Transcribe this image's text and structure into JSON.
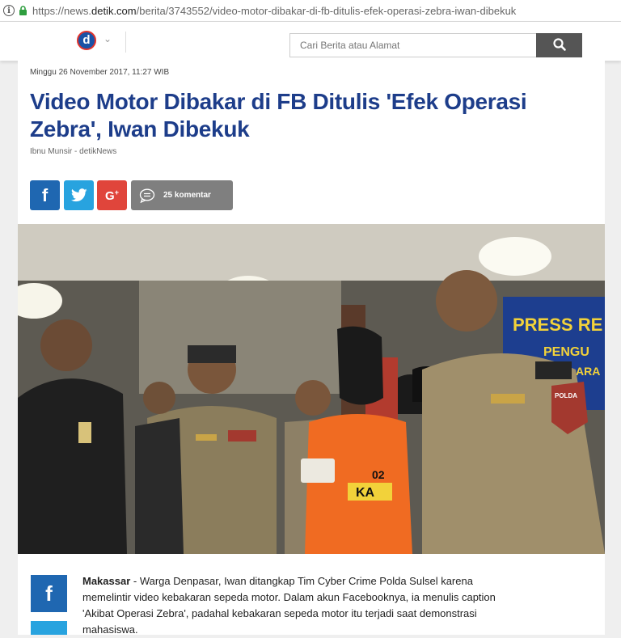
{
  "browser": {
    "url_prefix": "https://news.",
    "url_domain": "detik.com",
    "url_path": "/berita/3743552/video-motor-dibakar-di-fb-ditulis-efek-operasi-zebra-iwan-dibekuk"
  },
  "header": {
    "logo_letter": "d",
    "search_placeholder": "Cari Berita atau Alamat"
  },
  "article": {
    "date": "Minggu 26 November 2017, 11:27 WIB",
    "title": "Video Motor Dibakar di FB Ditulis 'Efek Operasi Zebra', Iwan Dibekuk",
    "author": "Ibnu Munsir - detikNews",
    "comments_label": "25 komentar",
    "location": "Makassar",
    "lead": " - Warga Denpasar, Iwan ditangkap Tim Cyber Crime Polda Sulsel karena memelintir video kebakaran sepeda motor. Dalam akun Facebooknya, ia menulis caption 'Akibat Operasi Zebra', padahal kebakaran sepeda motor itu terjadi saat demonstrasi mahasiswa."
  },
  "photo": {
    "banner_line1": "PRESS RE",
    "banner_line2": "PENGU",
    "banner_line3": "ARA",
    "shirt_number": "02",
    "shirt_text": "KA",
    "badge_text": "POLDA"
  },
  "colors": {
    "title": "#1d3d8a",
    "facebook": "#1f67b1",
    "twitter": "#28a3df",
    "googleplus": "#e0453b",
    "comments": "#7f7f7f"
  }
}
